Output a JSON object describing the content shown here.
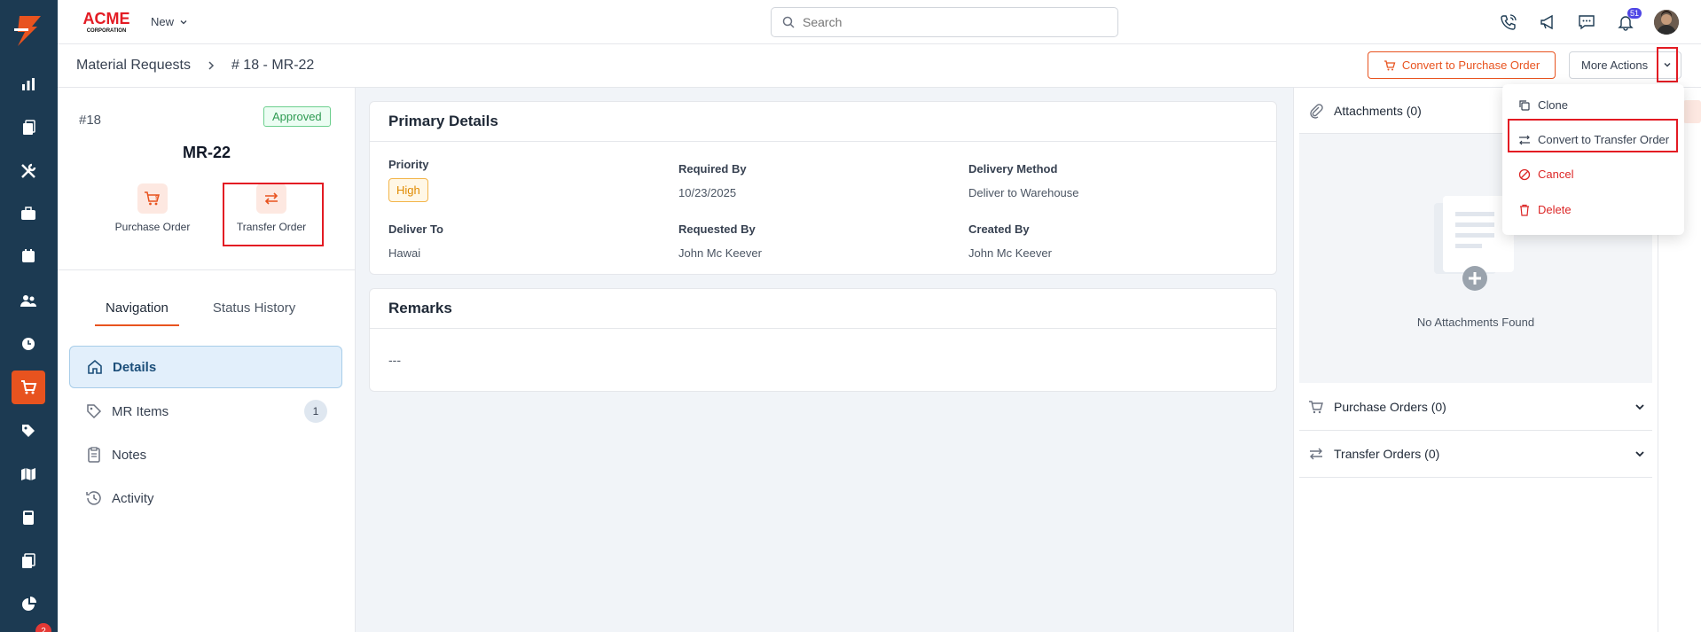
{
  "app": {
    "brand": "ACME",
    "brand_sub": "CORPORATION",
    "new_label": "New",
    "search_placeholder": "Search",
    "notification_count": "51",
    "sidebar_badge": "2"
  },
  "breadcrumb": {
    "parent": "Material Requests",
    "current": "# 18 - MR-22"
  },
  "toolbar": {
    "convert_po_label": "Convert to Purchase Order",
    "more_actions_label": "More Actions"
  },
  "request": {
    "id_label": "#18",
    "status": "Approved",
    "name": "MR-22",
    "quick_po": "Purchase Order",
    "quick_to": "Transfer Order"
  },
  "nav": {
    "tabs": [
      "Navigation",
      "Status History"
    ],
    "items": [
      {
        "label": "Details"
      },
      {
        "label": "MR Items",
        "count": "1"
      },
      {
        "label": "Notes"
      },
      {
        "label": "Activity"
      }
    ]
  },
  "primary": {
    "title": "Primary Details",
    "priority_label": "Priority",
    "priority_value": "High",
    "required_by_label": "Required By",
    "required_by_value": "10/23/2025",
    "delivery_method_label": "Delivery Method",
    "delivery_method_value": "Deliver to Warehouse",
    "deliver_to_label": "Deliver To",
    "deliver_to_value": "Hawai",
    "requested_by_label": "Requested By",
    "requested_by_value": "John Mc Keever",
    "created_by_label": "Created By",
    "created_by_value": "John Mc Keever"
  },
  "remarks": {
    "title": "Remarks",
    "value": "---"
  },
  "right": {
    "attachments_label": "Attachments (0)",
    "empty_msg": "No Attachments Found",
    "purchase_orders_label": "Purchase Orders (0)",
    "transfer_orders_label": "Transfer Orders (0)"
  },
  "menu": {
    "clone": "Clone",
    "convert_to": "Convert to Transfer Order",
    "cancel": "Cancel",
    "delete": "Delete"
  },
  "colors": {
    "accent": "#e8531f",
    "rail": "#1c3a52",
    "highlight": "#e31b23"
  }
}
